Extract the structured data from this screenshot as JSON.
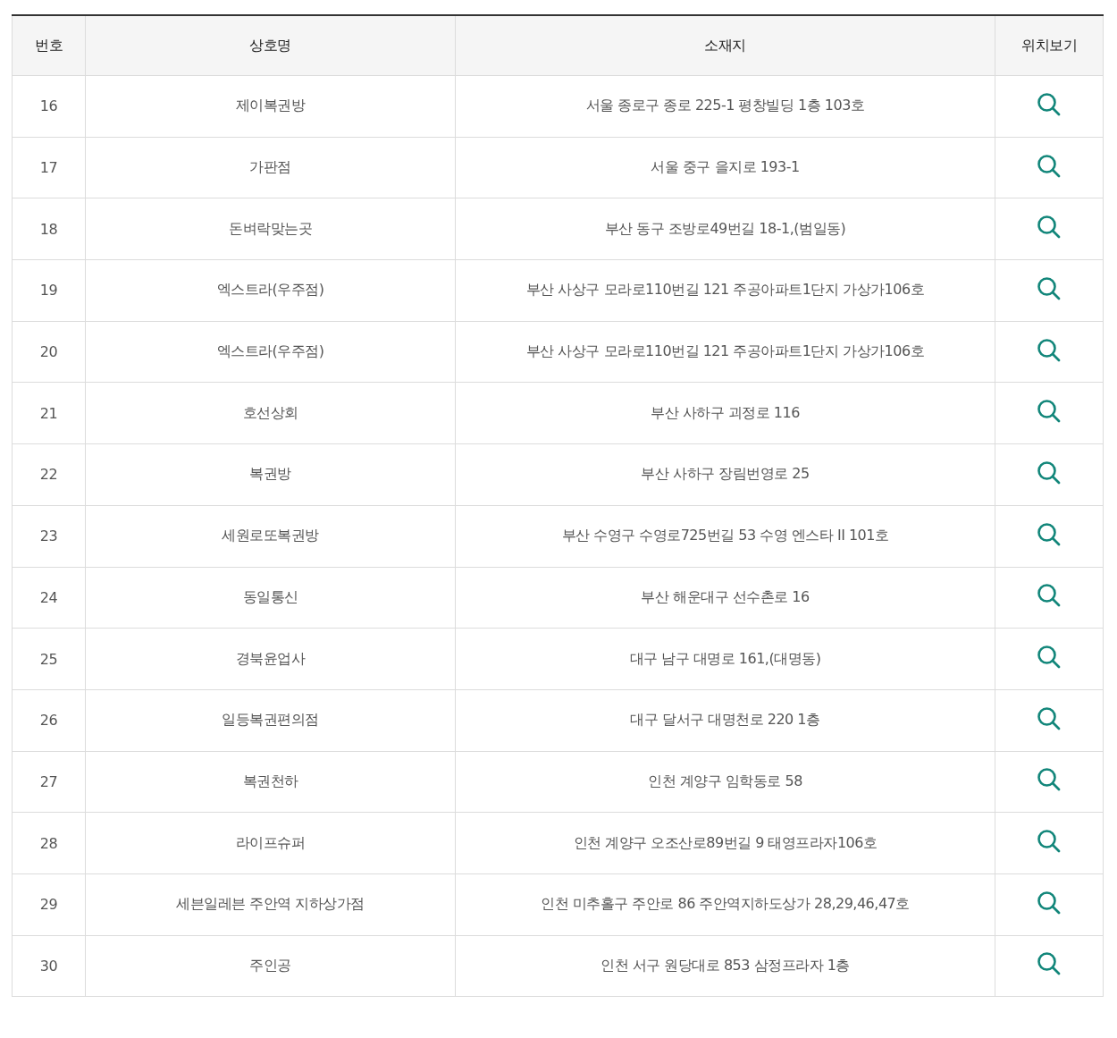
{
  "table": {
    "columns": [
      "번호",
      "상호명",
      "소재지",
      "위치보기"
    ],
    "rows": [
      {
        "number": "16",
        "name": "제이복권방",
        "address": "서울 종로구 종로 225-1 평창빌딩 1층 103호"
      },
      {
        "number": "17",
        "name": "가판점",
        "address": "서울 중구 을지로 193-1"
      },
      {
        "number": "18",
        "name": "돈벼락맞는곳",
        "address": "부산 동구 조방로49번길 18-1,(범일동)"
      },
      {
        "number": "19",
        "name": "엑스트라(우주점)",
        "address": "부산 사상구 모라로110번길 121 주공아파트1단지 가상가106호"
      },
      {
        "number": "20",
        "name": "엑스트라(우주점)",
        "address": "부산 사상구 모라로110번길 121 주공아파트1단지 가상가106호"
      },
      {
        "number": "21",
        "name": "호선상회",
        "address": "부산 사하구 괴정로 116"
      },
      {
        "number": "22",
        "name": "복권방",
        "address": "부산 사하구 장림번영로 25"
      },
      {
        "number": "23",
        "name": "세원로또복권방",
        "address": "부산 수영구 수영로725번길 53 수영 엔스타 II  101호"
      },
      {
        "number": "24",
        "name": "동일통신",
        "address": "부산 해운대구 선수촌로 16"
      },
      {
        "number": "25",
        "name": "경북윤업사",
        "address": "대구 남구 대명로 161,(대명동)"
      },
      {
        "number": "26",
        "name": "일등복권편의점",
        "address": "대구 달서구 대명천로 220 1층"
      },
      {
        "number": "27",
        "name": "복권천하",
        "address": "인천 계양구 임학동로 58"
      },
      {
        "number": "28",
        "name": "라이프슈퍼",
        "address": "인천 계양구 오조산로89번길 9 태영프라자106호"
      },
      {
        "number": "29",
        "name": "세븐일레븐 주안역 지하상가점",
        "address": "인천 미추홀구 주안로 86 주안역지하도상가 28,29,46,47호"
      },
      {
        "number": "30",
        "name": "주인공",
        "address": "인천 서구 원당대로 853 삼정프라자 1층"
      }
    ]
  }
}
